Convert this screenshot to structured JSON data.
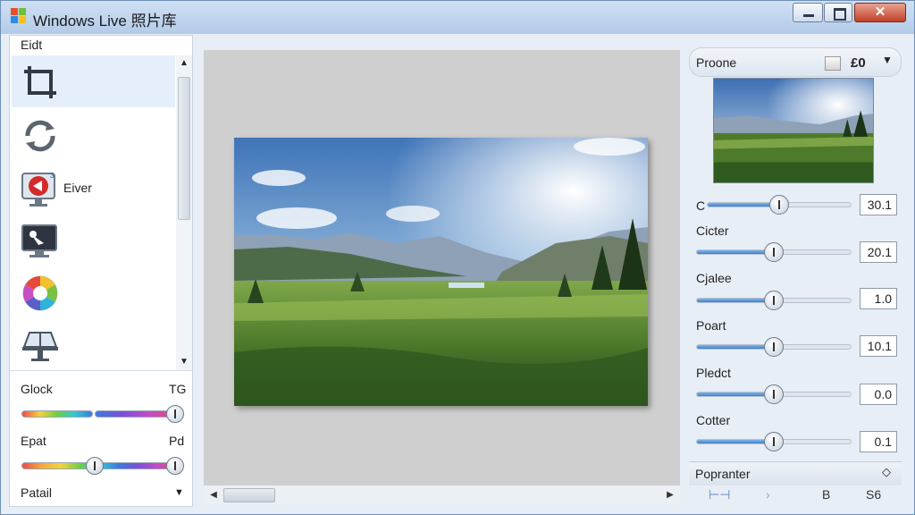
{
  "window": {
    "title": "Windows Live 照片库",
    "close_glyph": "✕",
    "min_label": "minimize",
    "max_label": "maximize"
  },
  "left_panel": {
    "header": "Eidt",
    "tools": [
      {
        "icon": "crop-icon",
        "label": ""
      },
      {
        "icon": "rotate-icon",
        "label": ""
      },
      {
        "icon": "red-eye-icon",
        "label": "Eiver"
      },
      {
        "icon": "monitor-edit-icon",
        "label": ""
      },
      {
        "icon": "color-wheel-icon",
        "label": ""
      },
      {
        "icon": "straighten-icon",
        "label": ""
      }
    ],
    "controls": {
      "color_label": "Glock",
      "color_value": "TG",
      "color_level": 0.99,
      "exposure_label": "Epat",
      "exposure_value": "Pd",
      "exposure_level1": 0.47,
      "exposure_level2": 0.99,
      "preset_label": "Patail",
      "preset_chevron": "▼"
    },
    "scroll_up": "▲",
    "scroll_down": "▼"
  },
  "center": {
    "scroll_left": "◀",
    "scroll_right": "▶"
  },
  "right_panel": {
    "header": "Proone",
    "header_icon": "£0",
    "header_chevron": "▼",
    "adjustments": [
      {
        "label": "C",
        "value": "30.1",
        "level": 0.5
      },
      {
        "label": "Cicter",
        "value": "20.1",
        "level": 0.5
      },
      {
        "label": "Cjalee",
        "value": "1.0",
        "level": 0.5
      },
      {
        "label": "Poart",
        "value": "10.1",
        "level": 0.5
      },
      {
        "label": "Pledct",
        "value": "0.0",
        "level": 0.5
      },
      {
        "label": "Cotter",
        "value": "0.1",
        "level": 0.5
      }
    ],
    "footer_label": "Popranter",
    "footer_icon": "◇",
    "tools": [
      "⊢⊣",
      "›",
      "B",
      "S6"
    ]
  },
  "colors": {
    "titlebar": "#b3cbe8",
    "accent": "#3e82cf",
    "canvas": "#cfcfcf"
  }
}
